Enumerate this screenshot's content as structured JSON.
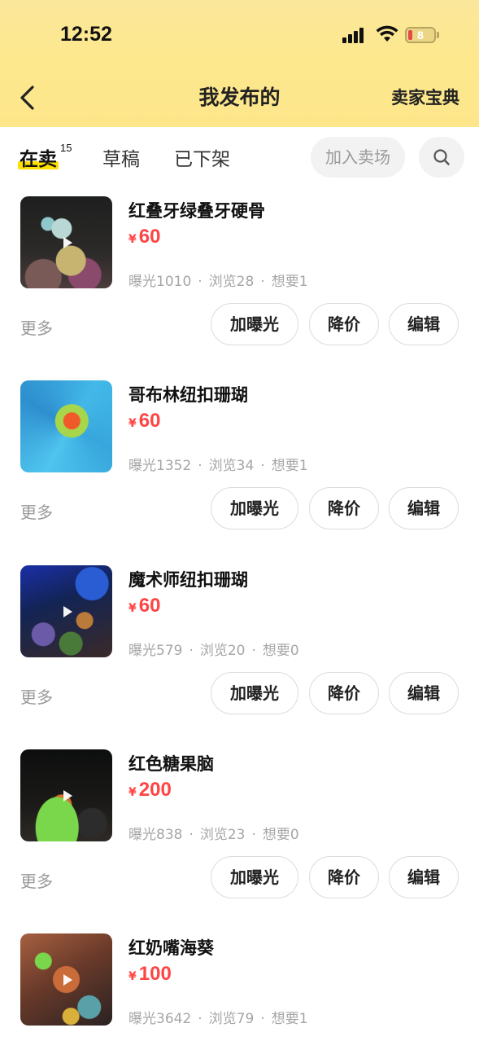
{
  "status_bar": {
    "time": "12:52",
    "battery_level": "8"
  },
  "nav": {
    "title": "我发布的",
    "right_link": "卖家宝典"
  },
  "tabs": [
    {
      "label": "在卖",
      "count": "15",
      "active": true
    },
    {
      "label": "草稿"
    },
    {
      "label": "已下架"
    }
  ],
  "join_market_label": "加入卖场",
  "items": [
    {
      "title": "红叠牙绿叠牙硬骨",
      "currency": "¥",
      "price": "60",
      "exposure": "曝光1010",
      "views": "浏览28",
      "wants": "想要1",
      "has_video": true
    },
    {
      "title": "哥布林纽扣珊瑚",
      "currency": "¥",
      "price": "60",
      "exposure": "曝光1352",
      "views": "浏览34",
      "wants": "想要1",
      "has_video": false
    },
    {
      "title": "魔术师纽扣珊瑚",
      "currency": "¥",
      "price": "60",
      "exposure": "曝光579",
      "views": "浏览20",
      "wants": "想要0",
      "has_video": true
    },
    {
      "title": "红色糖果脑",
      "currency": "¥",
      "price": "200",
      "exposure": "曝光838",
      "views": "浏览23",
      "wants": "想要0",
      "has_video": true
    },
    {
      "title": "红奶嘴海葵",
      "currency": "¥",
      "price": "100",
      "exposure": "曝光3642",
      "views": "浏览79",
      "wants": "想要1",
      "has_video": true
    }
  ],
  "actions": {
    "more": "更多",
    "boost": "加曝光",
    "reduce_price": "降价",
    "edit": "编辑"
  },
  "separator": "·",
  "colors": {
    "header_yellow": "#fde88e",
    "price_red": "#ff4444",
    "tab_highlight": "#ffe000"
  }
}
